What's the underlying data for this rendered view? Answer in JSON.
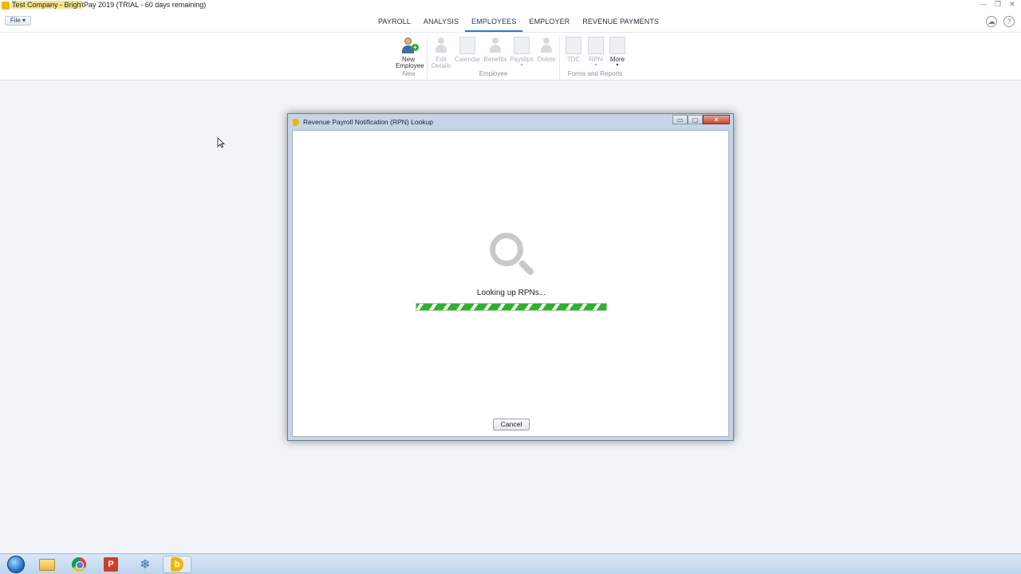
{
  "window": {
    "title_highlight": "Test Company - Brigh",
    "title_rest": "tPay 2019 (TRIAL - 60 days remaining)",
    "controls": {
      "minimize": "—",
      "restore": "❐",
      "close": "✕"
    }
  },
  "menu": {
    "file_label": "File ▾",
    "tabs": [
      "PAYROLL",
      "ANALYSIS",
      "EMPLOYEES",
      "EMPLOYER",
      "REVENUE PAYMENTS"
    ],
    "active_tab": "EMPLOYEES",
    "right_icons": {
      "cloud": "☁",
      "help": "?"
    }
  },
  "ribbon": {
    "groups": {
      "new": {
        "label": "New"
      },
      "employee": {
        "label": "Employee"
      },
      "forms": {
        "label": "Forms and Reports"
      }
    },
    "buttons": {
      "new_employee": {
        "line1": "New",
        "line2": "Employee"
      },
      "edit_details": {
        "line1": "Edit",
        "line2": "Details"
      },
      "calendar": {
        "line1": "Calendar"
      },
      "benefits": {
        "line1": "Benefits"
      },
      "payslips": {
        "line1": "Payslips",
        "arrow": "▾"
      },
      "delete": {
        "line1": "Delete"
      },
      "tdc": {
        "line1": "TDC"
      },
      "rpn": {
        "line1": "RPN",
        "arrow": "▾"
      },
      "more": {
        "line1": "More",
        "arrow": "▾"
      }
    }
  },
  "dialog": {
    "title": "Revenue Payroll Notification (RPN) Lookup",
    "controls": {
      "minimize": "▭",
      "maximize": "▢",
      "close": "✕"
    },
    "status_text": "Looking up RPNs...",
    "progress_percent": 100,
    "cancel_label": "Cancel"
  },
  "taskbar": {
    "powerpoint_glyph": "P",
    "snowflake_glyph": "❄",
    "brightpay_glyph": "b"
  }
}
